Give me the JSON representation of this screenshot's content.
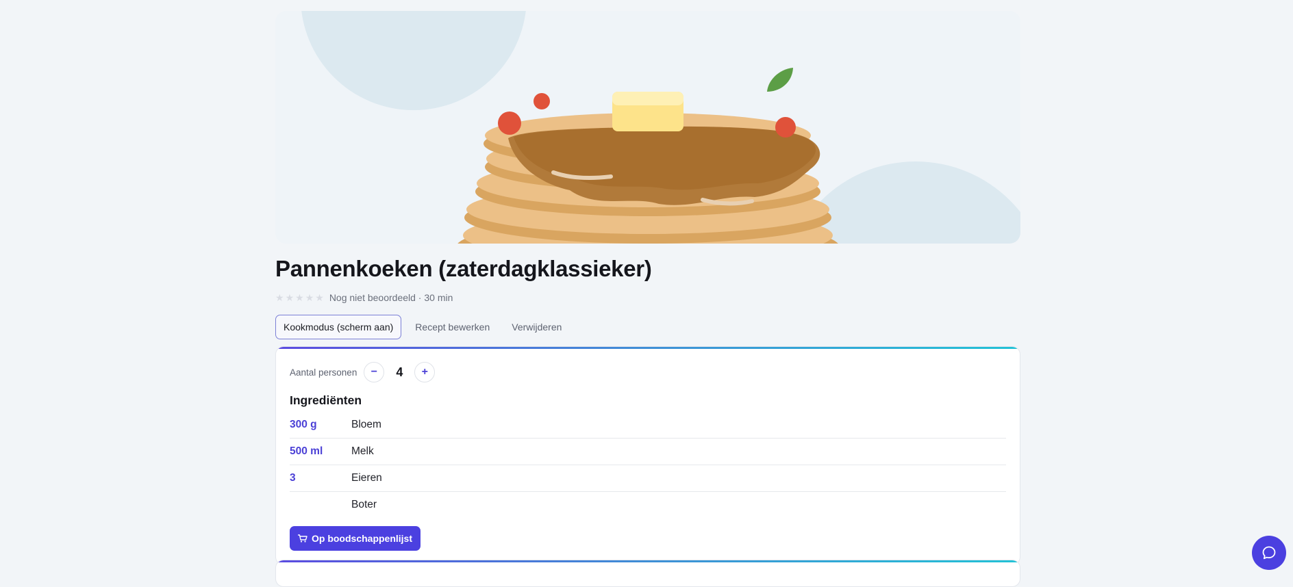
{
  "recipe": {
    "title": "Pannenkoeken (zaterdagklassieker)",
    "rating_stars": 5,
    "rating_text": "Nog niet beoordeeld",
    "separator": " · ",
    "duration": "30 min"
  },
  "actions": {
    "cook_mode": "Kookmodus (scherm aan)",
    "edit": "Recept bewerken",
    "delete": "Verwijderen"
  },
  "servings": {
    "label": "Aantal personen",
    "decrement": "−",
    "value": "4",
    "increment": "+"
  },
  "ingredients": {
    "title": "Ingrediënten",
    "items": [
      {
        "qty": "300 g",
        "name": "Bloem"
      },
      {
        "qty": "500 ml",
        "name": "Melk"
      },
      {
        "qty": "3",
        "name": "Eieren"
      },
      {
        "qty": "",
        "name": "Boter"
      }
    ]
  },
  "shopping": {
    "button_label": "Op boodschappenlijst",
    "icon": "cart-icon"
  },
  "chat": {
    "icon": "chat-bubble-icon"
  },
  "colors": {
    "accent": "#4b40e0",
    "background": "#f2f5f8"
  }
}
